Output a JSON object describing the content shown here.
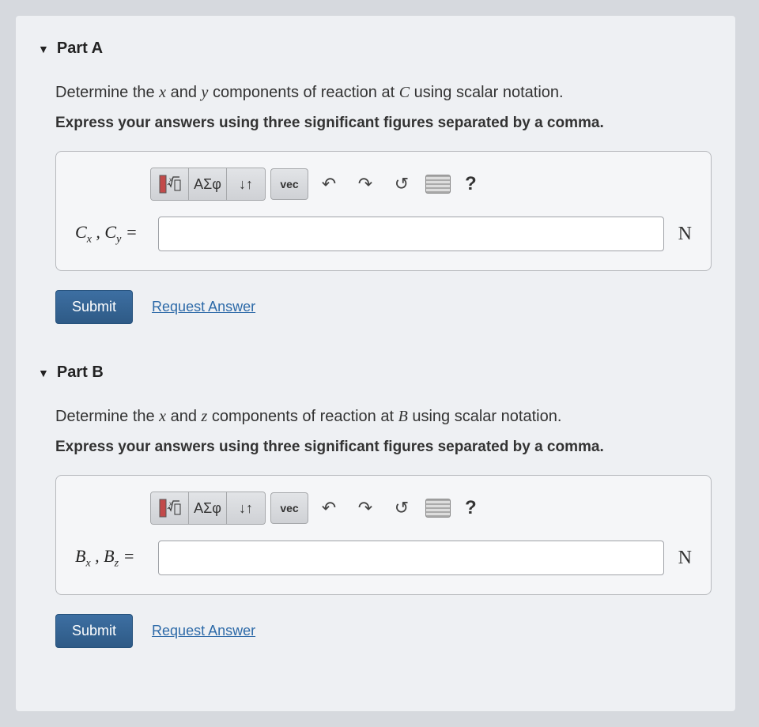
{
  "parts": [
    {
      "header": "Part A",
      "prompt_pre": "Determine the ",
      "prompt_var1": "x",
      "prompt_mid": " and ",
      "prompt_var2": "y",
      "prompt_post1": " components of reaction at ",
      "prompt_point": "C",
      "prompt_post2": " using scalar notation.",
      "instructions": "Express your answers using three significant figures separated by a comma.",
      "var_label_html": "C<sub>x</sub> , C<sub>y</sub> =",
      "var_c1": "C",
      "var_s1": "x",
      "var_sep": " , ",
      "var_c2": "C",
      "var_s2": "y",
      "var_eq": " =",
      "unit": "N",
      "submit": "Submit",
      "request": "Request Answer"
    },
    {
      "header": "Part B",
      "prompt_pre": "Determine the ",
      "prompt_var1": "x",
      "prompt_mid": " and ",
      "prompt_var2": "z",
      "prompt_post1": " components of reaction at ",
      "prompt_point": "B",
      "prompt_post2": " using scalar notation.",
      "instructions": "Express your answers using three significant figures separated by a comma.",
      "var_c1": "B",
      "var_s1": "x",
      "var_sep": " , ",
      "var_c2": "B",
      "var_s2": "z",
      "var_eq": " =",
      "unit": "N",
      "submit": "Submit",
      "request": "Request Answer"
    }
  ],
  "toolbar": {
    "greek": "ΑΣφ",
    "subsup": "↓↑",
    "vec": "vec",
    "help": "?"
  }
}
